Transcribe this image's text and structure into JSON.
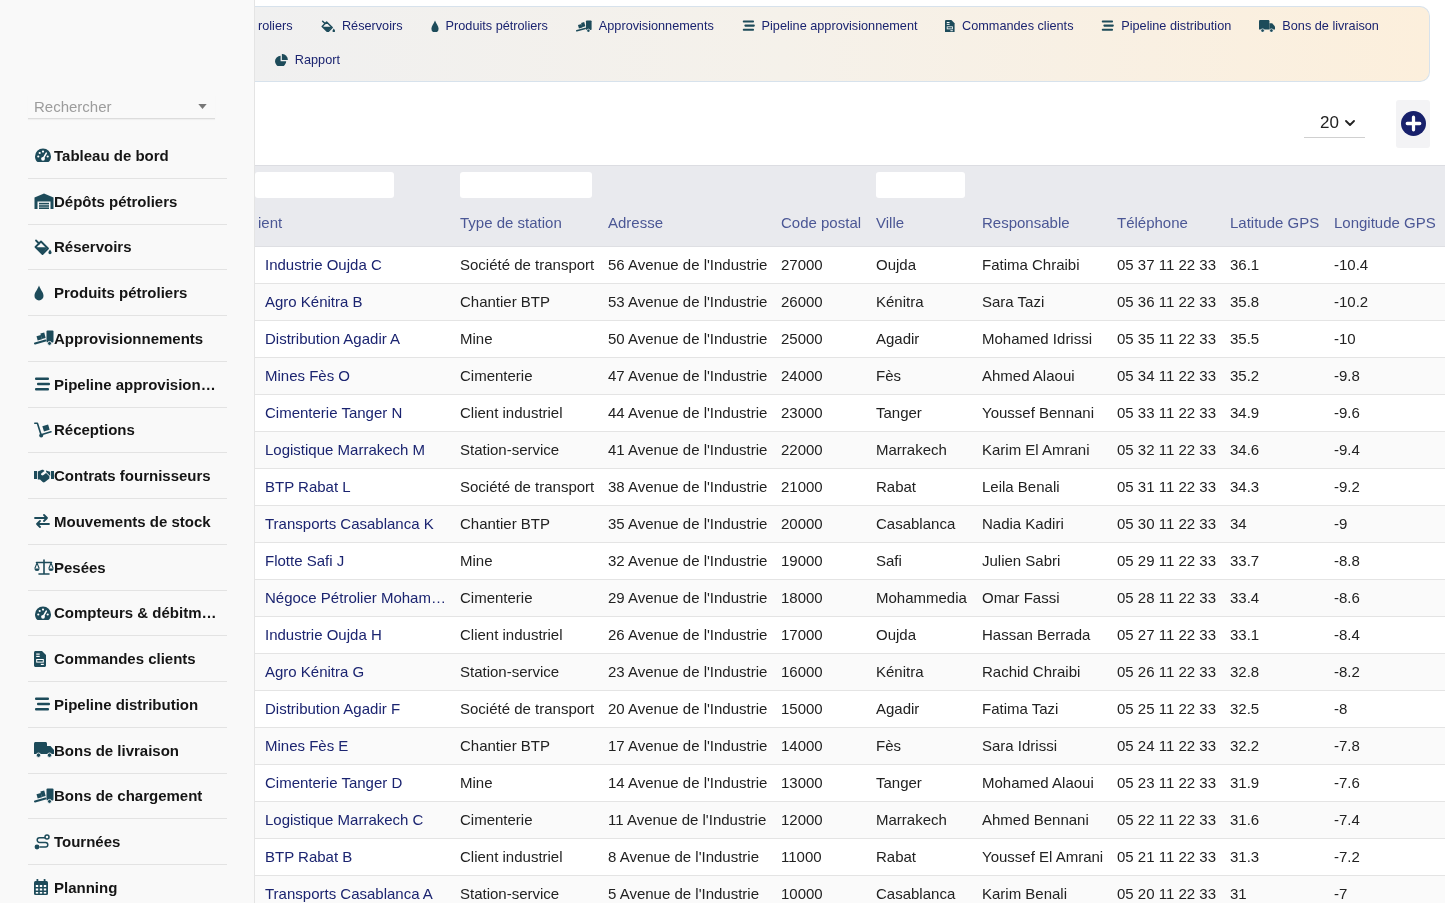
{
  "sidebar": {
    "search": {
      "placeholder": "Rechercher"
    },
    "items": [
      "Tableau de bord",
      "Dépôts pétroliers",
      "Réservoirs",
      "Produits pétroliers",
      "Approvisionnements",
      "Pipeline approvision…",
      "Réceptions",
      "Contrats fournisseurs",
      "Mouvements de stock",
      "Pesées",
      "Compteurs & débitm…",
      "Commandes clients",
      "Pipeline distribution",
      "Bons de livraison",
      "Bons de chargement",
      "Tournées",
      "Planning"
    ]
  },
  "top_nav": {
    "rows": [
      [
        "roliers",
        "Réservoirs",
        "Produits pétroliers",
        "Approvisionnements",
        "Pipeline approvisionnement",
        "Commandes clients",
        "Pipeline distribution",
        "Bons de livraison"
      ],
      [
        "Rapport"
      ]
    ]
  },
  "toolbar": {
    "page_size": "20"
  },
  "table": {
    "columns": [
      {
        "label": "ient",
        "filter": true
      },
      {
        "label": "Type de station",
        "filter": true
      },
      {
        "label": "Adresse",
        "filter": false
      },
      {
        "label": "Code postal",
        "filter": false
      },
      {
        "label": "Ville",
        "filter": true
      },
      {
        "label": "Responsable",
        "filter": false
      },
      {
        "label": "Téléphone",
        "filter": false
      },
      {
        "label": "Latitude GPS",
        "filter": false
      },
      {
        "label": "Longitude GPS",
        "filter": false
      }
    ],
    "rows": [
      [
        "Industrie Oujda C",
        "Société de transport",
        "56 Avenue de l'Industrie",
        "27000",
        "Oujda",
        "Fatima Chraibi",
        "05 37 11 22 33",
        "36.1",
        "-10.4"
      ],
      [
        "Agro Kénitra B",
        "Chantier BTP",
        "53 Avenue de l'Industrie",
        "26000",
        "Kénitra",
        "Sara Tazi",
        "05 36 11 22 33",
        "35.8",
        "-10.2"
      ],
      [
        "Distribution Agadir A",
        "Mine",
        "50 Avenue de l'Industrie",
        "25000",
        "Agadir",
        "Mohamed Idrissi",
        "05 35 11 22 33",
        "35.5",
        "-10"
      ],
      [
        "Mines Fès O",
        "Cimenterie",
        "47 Avenue de l'Industrie",
        "24000",
        "Fès",
        "Ahmed Alaoui",
        "05 34 11 22 33",
        "35.2",
        "-9.8"
      ],
      [
        "Cimenterie Tanger N",
        "Client industriel",
        "44 Avenue de l'Industrie",
        "23000",
        "Tanger",
        "Youssef Bennani",
        "05 33 11 22 33",
        "34.9",
        "-9.6"
      ],
      [
        "Logistique Marrakech M",
        "Station-service",
        "41 Avenue de l'Industrie",
        "22000",
        "Marrakech",
        "Karim El Amrani",
        "05 32 11 22 33",
        "34.6",
        "-9.4"
      ],
      [
        "BTP Rabat L",
        "Société de transport",
        "38 Avenue de l'Industrie",
        "21000",
        "Rabat",
        "Leila Benali",
        "05 31 11 22 33",
        "34.3",
        "-9.2"
      ],
      [
        "Transports Casablanca K",
        "Chantier BTP",
        "35 Avenue de l'Industrie",
        "20000",
        "Casablanca",
        "Nadia Kadiri",
        "05 30 11 22 33",
        "34",
        "-9"
      ],
      [
        "Flotte Safi J",
        "Mine",
        "32 Avenue de l'Industrie",
        "19000",
        "Safi",
        "Julien Sabri",
        "05 29 11 22 33",
        "33.7",
        "-8.8"
      ],
      [
        "Négoce Pétrolier Moham…",
        "Cimenterie",
        "29 Avenue de l'Industrie",
        "18000",
        "Mohammedia",
        "Omar Fassi",
        "05 28 11 22 33",
        "33.4",
        "-8.6"
      ],
      [
        "Industrie Oujda H",
        "Client industriel",
        "26 Avenue de l'Industrie",
        "17000",
        "Oujda",
        "Hassan Berrada",
        "05 27 11 22 33",
        "33.1",
        "-8.4"
      ],
      [
        "Agro Kénitra G",
        "Station-service",
        "23 Avenue de l'Industrie",
        "16000",
        "Kénitra",
        "Rachid Chraibi",
        "05 26 11 22 33",
        "32.8",
        "-8.2"
      ],
      [
        "Distribution Agadir F",
        "Société de transport",
        "20 Avenue de l'Industrie",
        "15000",
        "Agadir",
        "Fatima Tazi",
        "05 25 11 22 33",
        "32.5",
        "-8"
      ],
      [
        "Mines Fès E",
        "Chantier BTP",
        "17 Avenue de l'Industrie",
        "14000",
        "Fès",
        "Sara Idrissi",
        "05 24 11 22 33",
        "32.2",
        "-7.8"
      ],
      [
        "Cimenterie Tanger D",
        "Mine",
        "14 Avenue de l'Industrie",
        "13000",
        "Tanger",
        "Mohamed Alaoui",
        "05 23 11 22 33",
        "31.9",
        "-7.6"
      ],
      [
        "Logistique Marrakech C",
        "Cimenterie",
        "11 Avenue de l'Industrie",
        "12000",
        "Marrakech",
        "Ahmed Bennani",
        "05 22 11 22 33",
        "31.6",
        "-7.4"
      ],
      [
        "BTP Rabat B",
        "Client industriel",
        "8 Avenue de l'Industrie",
        "11000",
        "Rabat",
        "Youssef El Amrani",
        "05 21 11 22 33",
        "31.3",
        "-7.2"
      ],
      [
        "Transports Casablanca A",
        "Station-service",
        "5 Avenue de l'Industrie",
        "10000",
        "Casablanca",
        "Karim Benali",
        "05 20 11 22 33",
        "31",
        "-7"
      ]
    ]
  }
}
